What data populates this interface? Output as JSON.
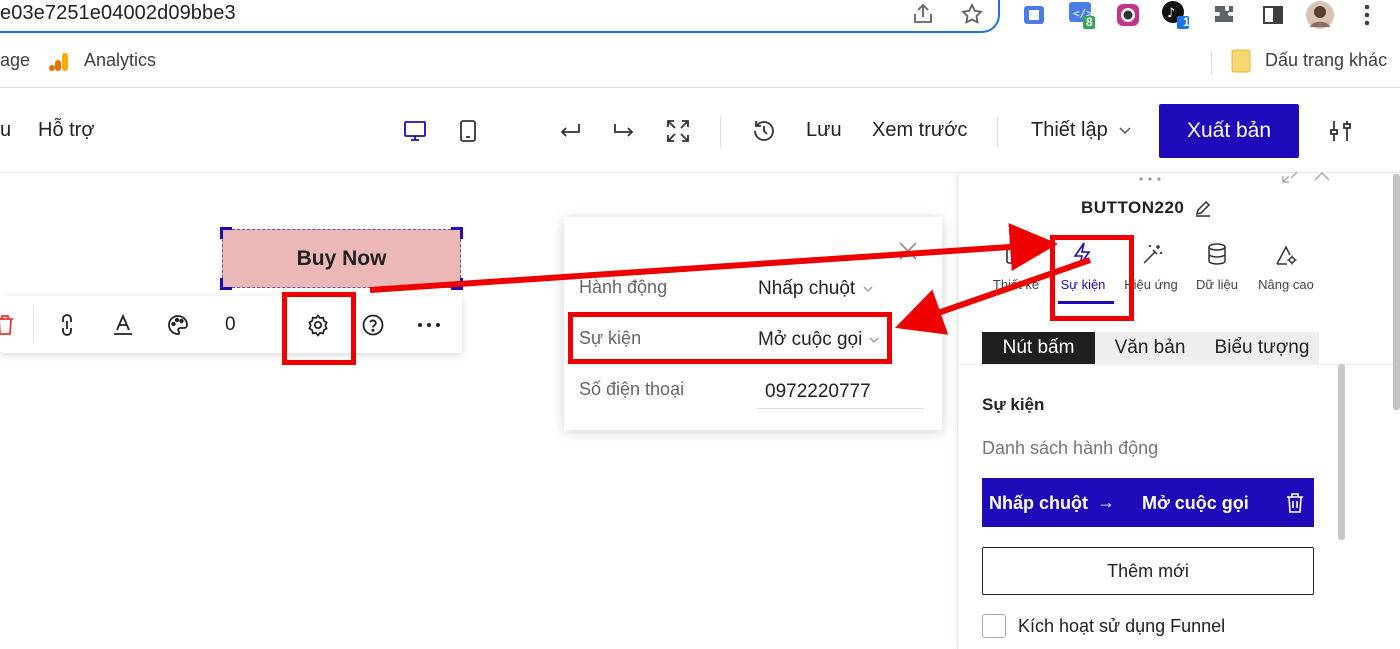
{
  "browser": {
    "url": "e03e7251e04002d09bbe3",
    "extension_badges": [
      "8",
      "1"
    ],
    "bookmarks": {
      "partial_left": "age",
      "analytics": "Analytics",
      "other_folder": "Dấu trang khác"
    }
  },
  "header": {
    "partial_menu": "u",
    "support": "Hỗ trợ",
    "save": "Lưu",
    "preview": "Xem trước",
    "settings": "Thiết lập",
    "publish": "Xuất bản"
  },
  "canvas": {
    "button_text": "Buy Now",
    "toolbar_count": "0"
  },
  "popup": {
    "action_label": "Hành động",
    "action_value": "Nhấp chuột",
    "event_label": "Sự kiện",
    "event_value": "Mở cuộc gọi",
    "phone_label": "Số điện thoại",
    "phone_value": "0972220777"
  },
  "panel": {
    "element_name": "BUTTON220",
    "tabs": [
      {
        "label": "Thiết kế",
        "icon": "design-icon"
      },
      {
        "label": "Sự kiện",
        "icon": "lightning-icon"
      },
      {
        "label": "Hiệu ứng",
        "icon": "magic-wand-icon"
      },
      {
        "label": "Dữ liệu",
        "icon": "database-icon"
      },
      {
        "label": "Nâng cao",
        "icon": "advanced-settings-icon"
      }
    ],
    "active_tab": "Sự kiện",
    "segments": [
      "Nút bấm",
      "Văn bản",
      "Biểu tượng"
    ],
    "section_title": "Sự kiện",
    "action_list_label": "Danh sách hành động",
    "action_item": {
      "trigger": "Nhấp chuột",
      "arrow": "→",
      "action": "Mở cuộc gọi"
    },
    "add_new": "Thêm mới",
    "funnel_label": "Kích hoạt sử dụng Funnel",
    "funnel_checked": false
  },
  "colors": {
    "accent": "#1e0ab8",
    "annotation": "#ee0000",
    "button_bg": "#ecb7b7"
  }
}
